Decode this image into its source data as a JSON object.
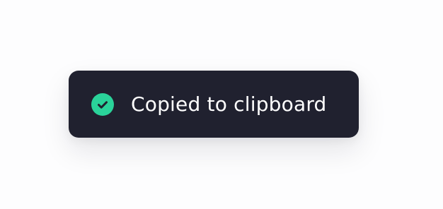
{
  "toast": {
    "message": "Copied to clipboard",
    "icon": "check-circle-icon",
    "background_color": "#20212f",
    "accent_color": "#2ad39a",
    "text_color": "#ffffff"
  }
}
